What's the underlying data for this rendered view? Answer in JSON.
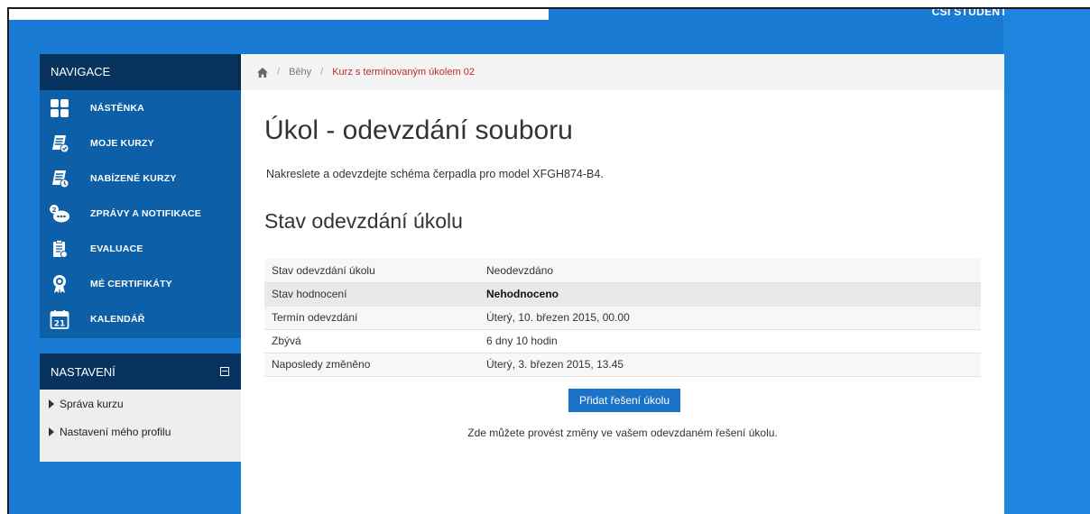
{
  "user": {
    "label": "CSI STUDENT"
  },
  "nav": {
    "header": "NAVIGACE",
    "items": [
      {
        "label": "NÁSTĚNKA",
        "icon": "dashboard-icon"
      },
      {
        "label": "MOJE KURZY",
        "icon": "my-courses-icon"
      },
      {
        "label": "NABÍZENÉ KURZY",
        "icon": "offered-courses-icon"
      },
      {
        "label": "ZPRÁVY A NOTIFIKACE",
        "icon": "messages-icon"
      },
      {
        "label": "EVALUACE",
        "icon": "evaluation-icon"
      },
      {
        "label": "MÉ CERTIFIKÁTY",
        "icon": "certificate-icon"
      },
      {
        "label": "KALENDÁŘ",
        "icon": "calendar-icon",
        "icon_text": "21"
      }
    ]
  },
  "settings": {
    "header": "NASTAVENÍ",
    "items": [
      {
        "label": "Správa kurzu"
      },
      {
        "label": "Nastavení mého profilu"
      }
    ]
  },
  "breadcrumb": {
    "items": [
      "Běhy",
      "Kurz s termínovaným úkolem 02"
    ]
  },
  "page": {
    "title": "Úkol - odevzdání souboru",
    "description": "Nakreslete a odevzdejte schéma čerpadla pro model XFGH874-B4.",
    "section_title": "Stav odevzdání úkolu"
  },
  "status_table": {
    "rows": [
      {
        "label": "Stav odevzdání úkolu",
        "value": "Neodevzdáno"
      },
      {
        "label": "Stav hodnocení",
        "value": "Nehodnoceno"
      },
      {
        "label": "Termín odevzdání",
        "value": "Úterý, 10. březen 2015, 00.00"
      },
      {
        "label": "Zbývá",
        "value": "6 dny 10 hodin"
      },
      {
        "label": "Naposledy změněno",
        "value": "Úterý, 3. březen 2015, 13.45"
      }
    ]
  },
  "actions": {
    "add_submission_label": "Přidat řešení úkolu",
    "info": "Zde můžete provést změny ve vašem odevzdaném řešení úkolu."
  },
  "colors": {
    "background_blue": "#1a7bd4",
    "nav_dark": "#08335e",
    "nav_blue": "#0d5fa8",
    "breadcrumb_current": "#c0272d",
    "button_blue": "#1a72c9"
  }
}
